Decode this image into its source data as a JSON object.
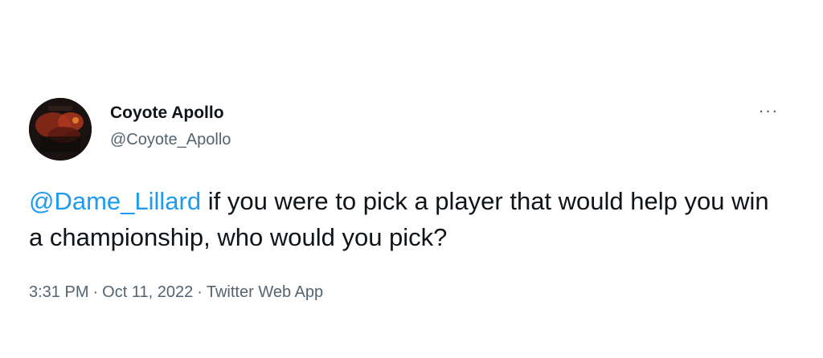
{
  "tweet": {
    "author": {
      "display_name": "Coyote Apollo",
      "handle": "@Coyote_Apollo"
    },
    "more_icon": "more-horizontal-icon",
    "more_glyph": "···",
    "mention": "@Dame_Lillard",
    "text": " if you were to pick a player that would help you win a championship, who would you pick?",
    "time": "3:31 PM",
    "separator": "·",
    "date": "Oct 11, 2022",
    "source": "Twitter Web App"
  },
  "colors": {
    "link": "#1d9bf0",
    "secondary_text": "#536471",
    "primary_text": "#0f1419",
    "background": "#ffffff"
  }
}
